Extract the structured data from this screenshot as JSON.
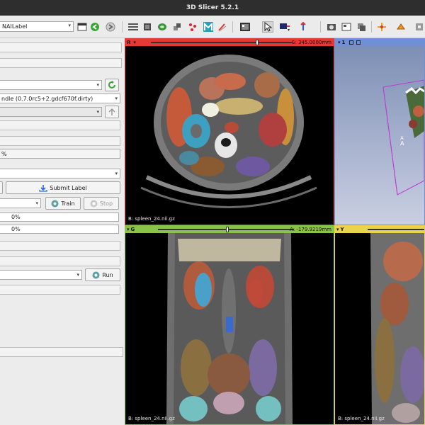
{
  "window": {
    "title": "3D Slicer 5.2.1"
  },
  "toolbar": {
    "module_combo": "NAILabel",
    "icons": [
      "layout-icon",
      "back-arrow-icon",
      "forward-arrow-icon",
      "data-icon",
      "volumes-icon",
      "models-icon",
      "transforms-icon",
      "markups-icon",
      "monai-icon",
      "editor-icon",
      "screenshot-icon",
      "cursor-icon",
      "crosshair-icon",
      "pin-icon",
      "capture-icon",
      "grid-icon",
      "layers-icon",
      "fiducial-icon",
      "roi-icon",
      "extension-icon"
    ]
  },
  "panel": {
    "model_version": "ndle (0.7.0rc5+2.gdcf670f.dirty)",
    "progress_field": "%",
    "submit_label": "Submit Label",
    "train_label": "Train",
    "stop_label": "Stop",
    "accuracy_1": "0%",
    "accuracy_2": "0%",
    "run_label": "Run"
  },
  "views": {
    "red": {
      "letter": "R",
      "offset": "S: 345.0000mm",
      "label": "B: spleen_24.nii.gz",
      "color": "#e53935"
    },
    "threeD": {
      "letter": "1",
      "color": "#6f8fd6",
      "annotation": "A"
    },
    "green": {
      "letter": "G",
      "offset": "A: -179.9219mm",
      "label": "B: spleen_24.nii.gz",
      "color": "#8bc34a"
    },
    "yellow": {
      "letter": "Y",
      "label": "B: spleen_24.nii.gz",
      "color": "#e8d44d"
    }
  }
}
